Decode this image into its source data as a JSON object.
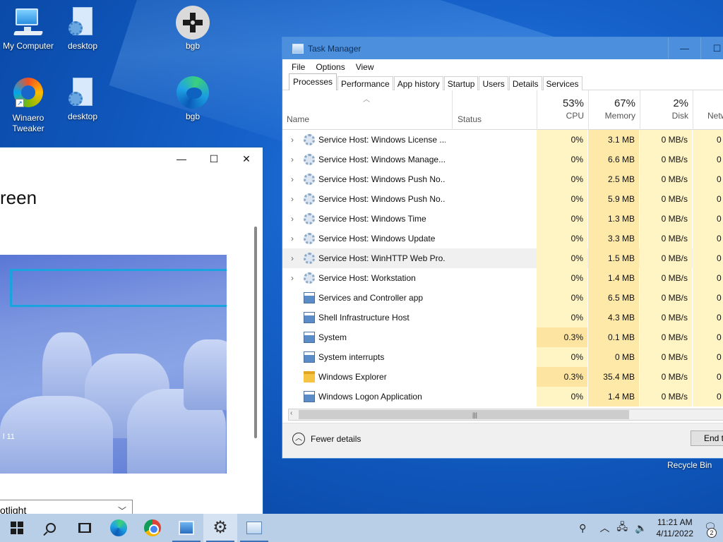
{
  "desktop": {
    "icons": [
      {
        "label": "My Computer",
        "icon": "computer-icon"
      },
      {
        "label": "desktop",
        "icon": "settings-file-icon"
      },
      {
        "label": "bgb",
        "icon": "bgb-gamepad-icon"
      },
      {
        "label": "Winaero Tweaker",
        "icon": "winaero-icon"
      },
      {
        "label": "desktop",
        "icon": "settings-file-icon"
      },
      {
        "label": "bgb",
        "icon": "edge-icon"
      }
    ],
    "recycle_bin": "Recycle Bin"
  },
  "settings_window": {
    "title": "reen",
    "caption": "l 11",
    "dropdown_value": "otlight",
    "controls": {
      "minimize": "—",
      "maximize": "☐",
      "close": "✕"
    }
  },
  "task_manager": {
    "title": "Task Manager",
    "menu": [
      "File",
      "Options",
      "View"
    ],
    "tabs": [
      "Processes",
      "Performance",
      "App history",
      "Startup",
      "Users",
      "Details",
      "Services"
    ],
    "active_tab": "Processes",
    "columns": {
      "name": "Name",
      "status": "Status",
      "cpu": {
        "pct": "53%",
        "label": "CPU"
      },
      "memory": {
        "pct": "67%",
        "label": "Memory"
      },
      "disk": {
        "pct": "2%",
        "label": "Disk"
      },
      "network": {
        "label": "Netw"
      }
    },
    "rows": [
      {
        "name": "Service Host: Windows License ...",
        "icon": "service-gear-icon",
        "expand": true,
        "cpu": "0%",
        "memory": "3.1 MB",
        "disk": "0 MB/s",
        "net": "0 M"
      },
      {
        "name": "Service Host: Windows Manage...",
        "icon": "service-gear-icon",
        "expand": true,
        "cpu": "0%",
        "memory": "6.6 MB",
        "disk": "0 MB/s",
        "net": "0 M"
      },
      {
        "name": "Service Host: Windows Push No...",
        "icon": "service-gear-icon",
        "expand": true,
        "cpu": "0%",
        "memory": "2.5 MB",
        "disk": "0 MB/s",
        "net": "0 M"
      },
      {
        "name": "Service Host: Windows Push No...",
        "icon": "service-gear-icon",
        "expand": true,
        "cpu": "0%",
        "memory": "5.9 MB",
        "disk": "0 MB/s",
        "net": "0 M"
      },
      {
        "name": "Service Host: Windows Time",
        "icon": "service-gear-icon",
        "expand": true,
        "cpu": "0%",
        "memory": "1.3 MB",
        "disk": "0 MB/s",
        "net": "0 M"
      },
      {
        "name": "Service Host: Windows Update",
        "icon": "service-gear-icon",
        "expand": true,
        "cpu": "0%",
        "memory": "3.3 MB",
        "disk": "0 MB/s",
        "net": "0 M"
      },
      {
        "name": "Service Host: WinHTTP Web Pro...",
        "icon": "service-gear-icon",
        "expand": true,
        "cpu": "0%",
        "memory": "1.5 MB",
        "disk": "0 MB/s",
        "net": "0 M",
        "selected": true
      },
      {
        "name": "Service Host: Workstation",
        "icon": "service-gear-icon",
        "expand": true,
        "cpu": "0%",
        "memory": "1.4 MB",
        "disk": "0 MB/s",
        "net": "0 M"
      },
      {
        "name": "Services and Controller app",
        "icon": "app-window-icon",
        "expand": false,
        "cpu": "0%",
        "memory": "6.5 MB",
        "disk": "0 MB/s",
        "net": "0 M"
      },
      {
        "name": "Shell Infrastructure Host",
        "icon": "app-window-icon",
        "expand": false,
        "cpu": "0%",
        "memory": "4.3 MB",
        "disk": "0 MB/s",
        "net": "0 M"
      },
      {
        "name": "System",
        "icon": "app-window-icon",
        "expand": false,
        "cpu": "0.3%",
        "memory": "0.1 MB",
        "disk": "0 MB/s",
        "net": "0 M"
      },
      {
        "name": "System interrupts",
        "icon": "app-window-icon",
        "expand": false,
        "cpu": "0%",
        "memory": "0 MB",
        "disk": "0 MB/s",
        "net": "0 M"
      },
      {
        "name": "Windows Explorer",
        "icon": "folder-icon",
        "expand": false,
        "cpu": "0.3%",
        "memory": "35.4 MB",
        "disk": "0 MB/s",
        "net": "0 M"
      },
      {
        "name": "Windows Logon Application",
        "icon": "app-window-icon",
        "expand": false,
        "cpu": "0%",
        "memory": "1.4 MB",
        "disk": "0 MB/s",
        "net": "0 M"
      }
    ],
    "fewer_details": "Fewer details",
    "end_task": "End t",
    "controls": {
      "minimize": "—",
      "maximize": "☐"
    }
  },
  "taskbar": {
    "clock_time": "11:21 AM",
    "clock_date": "4/11/2022",
    "notification_count": "2",
    "icons": [
      "windows-start-icon",
      "search-icon",
      "task-view-icon",
      "edge-icon",
      "chrome-icon",
      "this-pc-icon",
      "settings-gear-icon",
      "task-manager-icon"
    ]
  }
}
